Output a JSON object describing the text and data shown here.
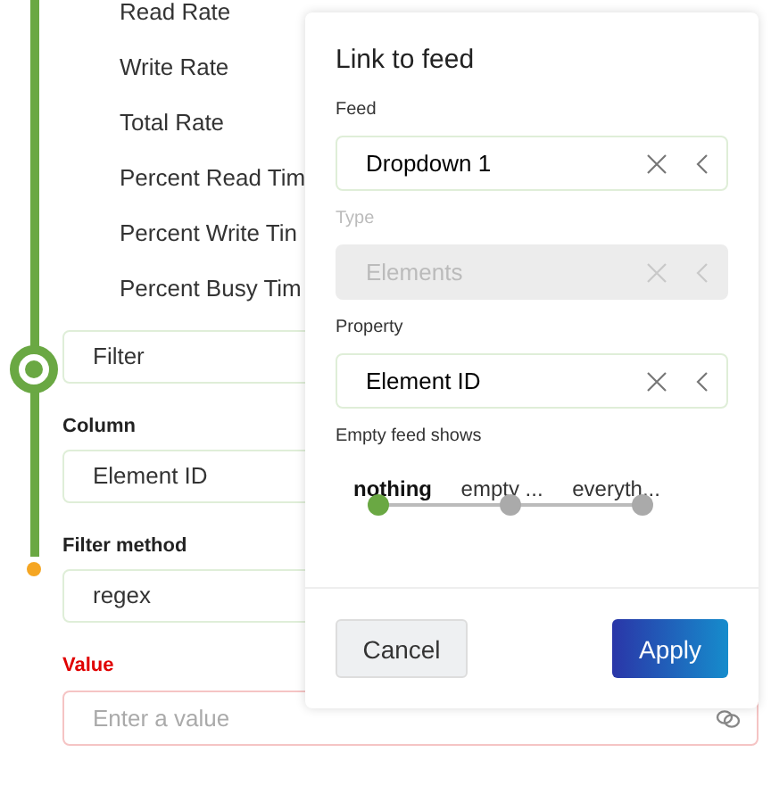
{
  "metrics": [
    "Read Rate",
    "Write Rate",
    "Total Rate",
    "Percent Read Tim",
    "Percent Write Tin",
    "Percent Busy Tim"
  ],
  "filter_field": {
    "value": "Filter"
  },
  "fields": [
    {
      "label": "Column",
      "value": "Element ID"
    },
    {
      "label": "Filter method",
      "value": "regex"
    }
  ],
  "value_field": {
    "label": "Value",
    "placeholder": "Enter a value",
    "error": true
  },
  "popup": {
    "title": "Link to feed",
    "fields": [
      {
        "label": "Feed",
        "value": "Dropdown 1",
        "disabled": false
      },
      {
        "label": "Type",
        "value": "Elements",
        "disabled": true
      },
      {
        "label": "Property",
        "value": "Element ID",
        "disabled": false
      }
    ],
    "empty_feed": {
      "label": "Empty feed shows",
      "options": [
        {
          "label": "nothing",
          "selected": true
        },
        {
          "label": "empty ...",
          "selected": false
        },
        {
          "label": "everyth...",
          "selected": false
        }
      ]
    },
    "buttons": [
      {
        "label": "Cancel",
        "kind": "secondary"
      },
      {
        "label": "Apply",
        "kind": "primary"
      }
    ]
  }
}
